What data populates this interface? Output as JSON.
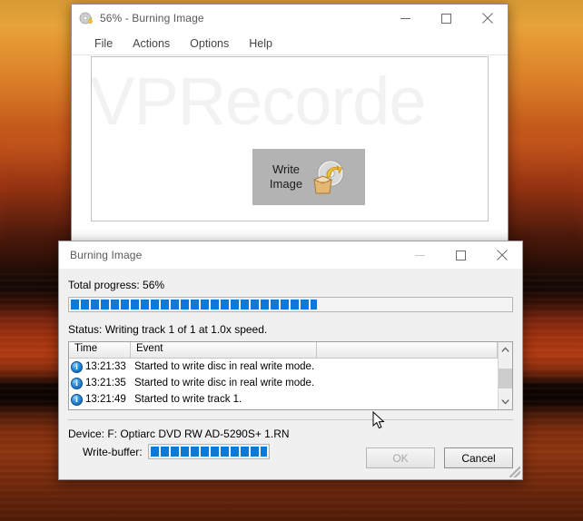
{
  "desktop": {
    "name": "sunset-wallpaper"
  },
  "main_window": {
    "title": "56% - Burning Image",
    "icon": "burning-disc-icon",
    "caption": {
      "minimize": "—",
      "maximize": "□",
      "close": "✕"
    },
    "menu": [
      {
        "label": "File"
      },
      {
        "label": "Actions"
      },
      {
        "label": "Options"
      },
      {
        "label": "Help"
      }
    ],
    "watermark": "VPRecorde",
    "write_image_button": {
      "line1": "Write",
      "line2": "Image",
      "icon": "write-image-disc-box-icon"
    }
  },
  "dialog": {
    "title": "Burning Image",
    "caption": {
      "minimize": "—",
      "maximize": "□",
      "close": "✕"
    },
    "total_progress_label": "Total progress: 56%",
    "total_progress_percent": 56,
    "status_label": "Status: Writing track 1 of 1 at 1.0x speed.",
    "log": {
      "columns": [
        "Time",
        "Event",
        ""
      ],
      "rows": [
        {
          "time": "13:21:33",
          "event": "Started to write disc in real write mode.",
          "icon": "info-icon"
        },
        {
          "time": "13:21:35",
          "event": "Started to write disc in real write mode.",
          "icon": "info-icon"
        },
        {
          "time": "13:21:49",
          "event": "Started to write track 1.",
          "icon": "info-icon"
        }
      ],
      "scroll_up": "∧",
      "scroll_down": "∨"
    },
    "device_label": "Device: F: Optiarc DVD RW AD-5290S+ 1.RN",
    "write_buffer_label": "Write-buffer:",
    "write_buffer_percent": 100,
    "buttons": {
      "ok": "OK",
      "cancel": "Cancel"
    }
  },
  "colors": {
    "progress_blue": "#0b7ad6",
    "title_text": "#5a5a5a",
    "button_face": "#f0f0f0",
    "write_button_bg": "#b3b3b3"
  }
}
